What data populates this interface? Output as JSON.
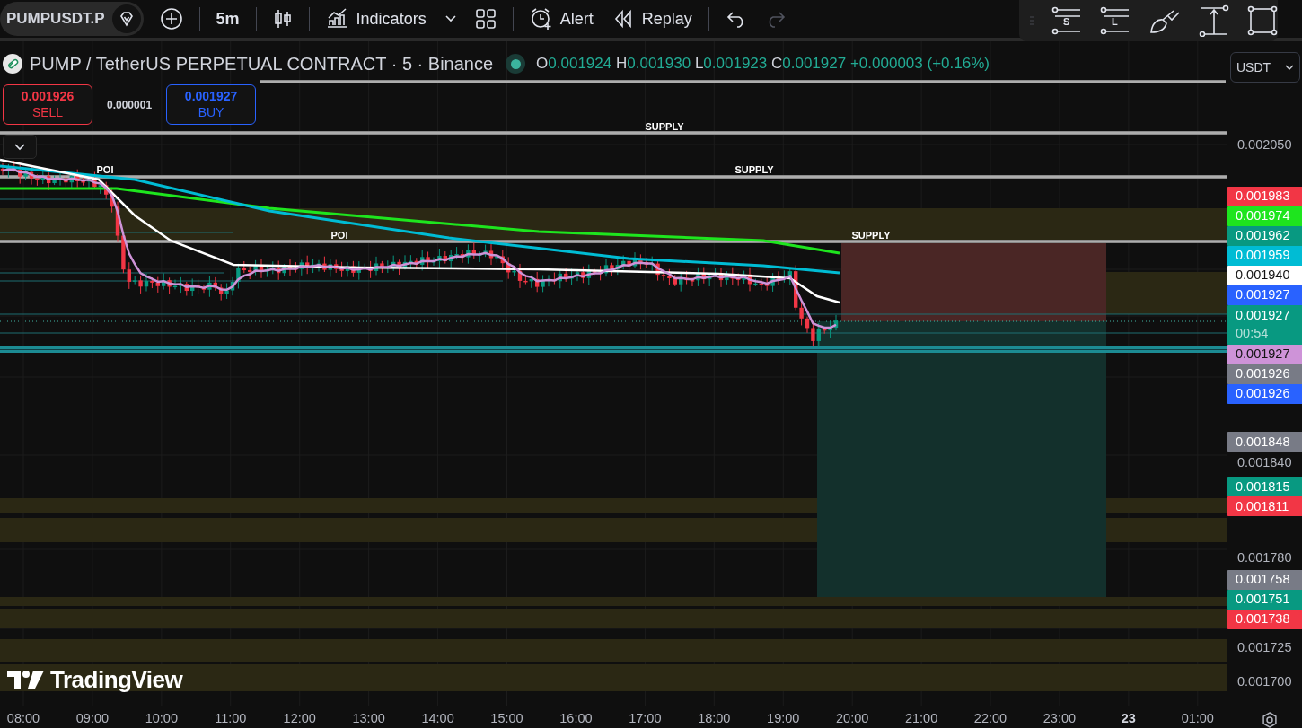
{
  "toolbar": {
    "symbol": "PUMPUSDT.P",
    "interval": "5m",
    "buttons": [
      {
        "kind": "indicators",
        "label": "Indicators"
      },
      {
        "kind": "alert",
        "label": "Alert"
      },
      {
        "kind": "replay",
        "label": "Replay"
      }
    ],
    "undo": {
      "disabled": false
    },
    "redo": {
      "disabled": true
    }
  },
  "drawing_tools": [
    {
      "kind": "short",
      "label": "S"
    },
    {
      "kind": "long",
      "label": "L"
    },
    {
      "kind": "brush"
    },
    {
      "kind": "measure"
    },
    {
      "kind": "rectangle"
    }
  ],
  "legend": {
    "title": "PUMP / TetherUS PERPETUAL CONTRACT · 5 · Binance",
    "values": [
      {
        "label": "O",
        "value": "0.001924"
      },
      {
        "label": "H",
        "value": "0.001930"
      },
      {
        "label": "L",
        "value": "0.001923"
      },
      {
        "label": "C",
        "value": "0.001927"
      }
    ],
    "change": "+0.000003 (+0.16%)"
  },
  "currency": "USDT",
  "trade": {
    "sell_price": "0.001926",
    "sell_label": "SELL",
    "spread": "0.000001",
    "buy_price": "0.001927",
    "buy_label": "BUY"
  },
  "zone_labels": [
    {
      "text": "SUPPLY"
    },
    {
      "text": "SUPPLY"
    },
    {
      "text": "POI"
    },
    {
      "text": "POI"
    },
    {
      "text": "SUPPLY"
    }
  ],
  "logo": "TradingView",
  "price_axis": [
    {
      "kind": "tick",
      "price": "0.002050"
    },
    {
      "kind": "marker",
      "price": "0.001983",
      "color": "#f23645"
    },
    {
      "kind": "marker",
      "price": "0.001974",
      "color": "#1ee51e"
    },
    {
      "kind": "marker",
      "price": "0.001962",
      "color": "#089981"
    },
    {
      "kind": "marker",
      "price": "0.001959",
      "color": "#00bcd4"
    },
    {
      "kind": "marker",
      "price": "0.001940",
      "color": "#ffffff"
    },
    {
      "kind": "marker",
      "price": "0.001927",
      "color": "#2962ff"
    },
    {
      "kind": "marker",
      "price": "0.001927",
      "color": "#089981",
      "countdown": "00:54"
    },
    {
      "kind": "marker",
      "price": "0.001927",
      "color": "#ce93d8"
    },
    {
      "kind": "marker",
      "price": "0.001926",
      "color": "#787b86"
    },
    {
      "kind": "marker",
      "price": "0.001926",
      "color": "#2962ff"
    },
    {
      "kind": "marker",
      "price": "0.001848",
      "color": "#787b86"
    },
    {
      "kind": "tick",
      "price": "0.001840"
    },
    {
      "kind": "marker",
      "price": "0.001815",
      "color": "#089981"
    },
    {
      "kind": "marker",
      "price": "0.001811",
      "color": "#f23645"
    },
    {
      "kind": "tick",
      "price": "0.001780"
    },
    {
      "kind": "marker",
      "price": "0.001758",
      "color": "#787b86"
    },
    {
      "kind": "marker",
      "price": "0.001751",
      "color": "#089981"
    },
    {
      "kind": "marker",
      "price": "0.001738",
      "color": "#f23645"
    },
    {
      "kind": "tick",
      "price": "0.001725"
    },
    {
      "kind": "tick",
      "price": "0.001700"
    }
  ],
  "time_axis": [
    {
      "label": "08:00",
      "kind": "time"
    },
    {
      "label": "09:00",
      "kind": "time"
    },
    {
      "label": "10:00",
      "kind": "time"
    },
    {
      "label": "11:00",
      "kind": "time"
    },
    {
      "label": "12:00",
      "kind": "time"
    },
    {
      "label": "13:00",
      "kind": "time"
    },
    {
      "label": "14:00",
      "kind": "time"
    },
    {
      "label": "15:00",
      "kind": "time"
    },
    {
      "label": "16:00",
      "kind": "time"
    },
    {
      "label": "17:00",
      "kind": "time"
    },
    {
      "label": "18:00",
      "kind": "time"
    },
    {
      "label": "19:00",
      "kind": "time"
    },
    {
      "label": "20:00",
      "kind": "time"
    },
    {
      "label": "21:00",
      "kind": "time"
    },
    {
      "label": "22:00",
      "kind": "time"
    },
    {
      "label": "23:00",
      "kind": "time"
    },
    {
      "label": "23",
      "kind": "day"
    },
    {
      "label": "01:00",
      "kind": "time"
    }
  ]
}
